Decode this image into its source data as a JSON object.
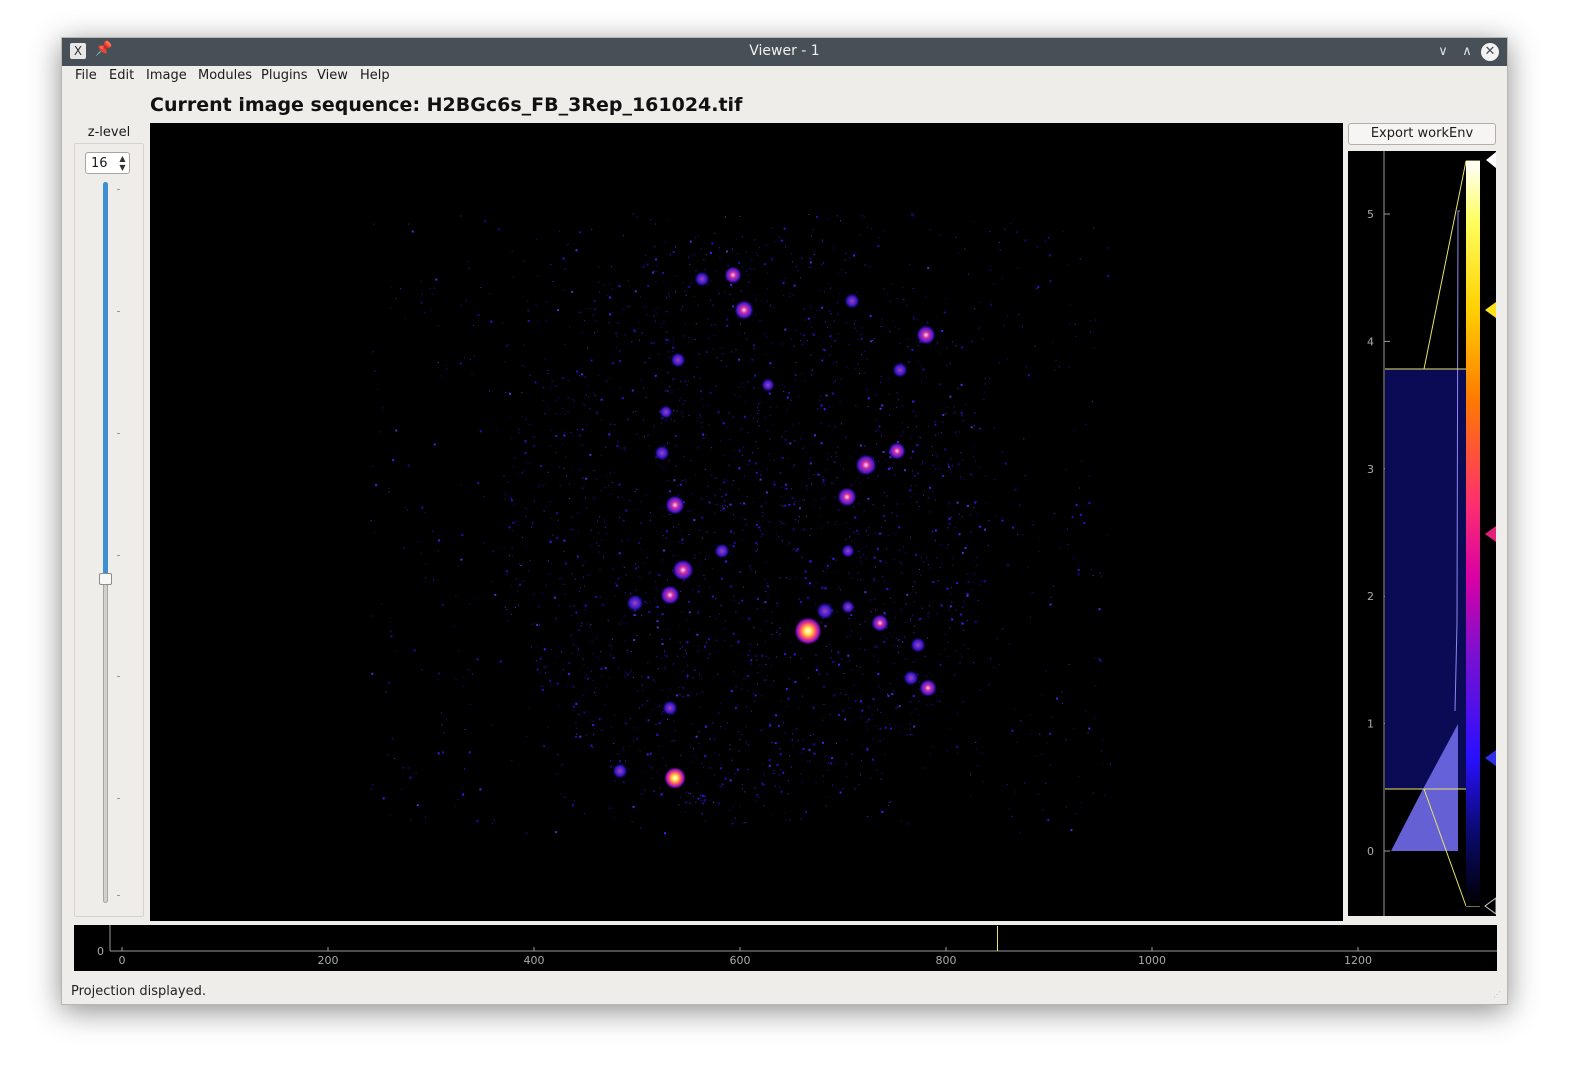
{
  "window": {
    "title": "Viewer - 1",
    "app_icon": "X",
    "pin_icon": "📌",
    "minimize_icon": "∨",
    "maximize_icon": "∧",
    "close_icon": "✕"
  },
  "menu": {
    "items": [
      "File",
      "Edit",
      "Image",
      "Modules",
      "Plugins",
      "View",
      "Help"
    ]
  },
  "main": {
    "sequence_title": "Current image sequence: H2BGc6s_FB_3Rep_161024.tif"
  },
  "zlevel": {
    "label": "z-level",
    "value": "16",
    "spin_up": "▲",
    "spin_down": "▼",
    "slider_fraction": 0.55
  },
  "export": {
    "button_label": "Export workEnv"
  },
  "histogram": {
    "y_ticks": [
      "5",
      "4",
      "3",
      "2",
      "1",
      "0"
    ],
    "colormap_colors": [
      "#ffffff",
      "#ffff60",
      "#ffd000",
      "#ff7a00",
      "#ff2f6e",
      "#d800a4",
      "#7c10d0",
      "#2a10ff",
      "#0a0a70",
      "#000000"
    ],
    "handle_colors": [
      "#ffffff",
      "#ffe11a",
      "#e0207a",
      "#3030e8",
      "#000000"
    ],
    "line_color": "#e7e36a"
  },
  "timeline": {
    "y_tick": "0",
    "x_ticks": [
      "0",
      "200",
      "400",
      "600",
      "800",
      "1000",
      "1200"
    ],
    "current_frame": 850
  },
  "status": {
    "text": "Projection displayed."
  }
}
